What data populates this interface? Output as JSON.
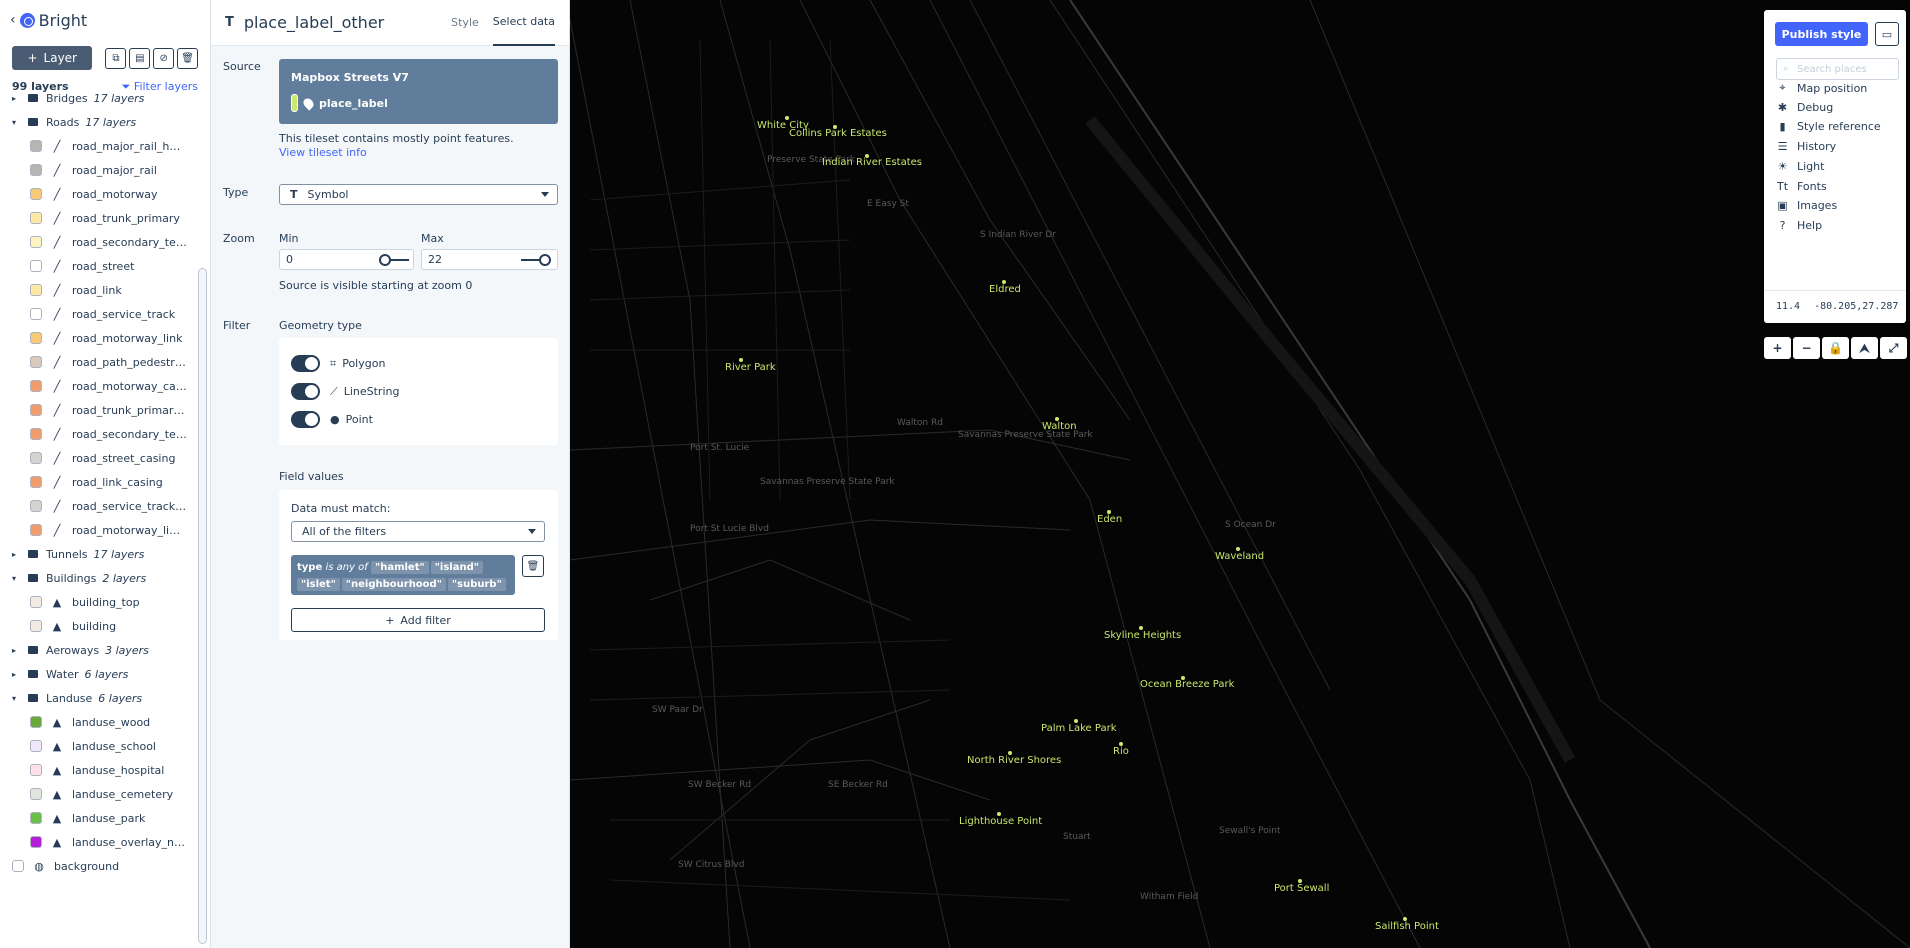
{
  "app": {
    "style_name": "Bright",
    "add_layer_label": "Layer",
    "layer_count": "99 layers",
    "filter_layers_label": "Filter layers"
  },
  "groups": [
    {
      "name": "Bridges",
      "count": "17 layers",
      "expanded": false,
      "layers": []
    },
    {
      "name": "Roads",
      "count": "17 layers",
      "expanded": true,
      "layers": [
        {
          "name": "road_major_rail_hatchi…",
          "color": "#b5b5b5",
          "icon": "line"
        },
        {
          "name": "road_major_rail",
          "color": "#b5b5b5",
          "icon": "line"
        },
        {
          "name": "road_motorway",
          "color": "#f7c97a",
          "icon": "line"
        },
        {
          "name": "road_trunk_primary",
          "color": "#fde9a5",
          "icon": "line"
        },
        {
          "name": "road_secondary_tertiary",
          "color": "#fdf4c2",
          "icon": "line"
        },
        {
          "name": "road_street",
          "color": "#ffffff",
          "icon": "line"
        },
        {
          "name": "road_link",
          "color": "#fde9a5",
          "icon": "line"
        },
        {
          "name": "road_service_track",
          "color": "#ffffff",
          "icon": "line"
        },
        {
          "name": "road_motorway_link",
          "color": "#f7c97a",
          "icon": "line"
        },
        {
          "name": "road_path_pedestrian",
          "color": "#d8cbbd",
          "icon": "line"
        },
        {
          "name": "road_motorway_casing",
          "color": "#ef9d6c",
          "icon": "line"
        },
        {
          "name": "road_trunk_primary_ca…",
          "color": "#ef9d6c",
          "icon": "line"
        },
        {
          "name": "road_secondary_tertia…",
          "color": "#ef9d6c",
          "icon": "line"
        },
        {
          "name": "road_street_casing",
          "color": "#d3d3d3",
          "icon": "line"
        },
        {
          "name": "road_link_casing",
          "color": "#ef9d6c",
          "icon": "line"
        },
        {
          "name": "road_service_track_cas…",
          "color": "#d3d3d3",
          "icon": "line"
        },
        {
          "name": "road_motorway_link_c…",
          "color": "#ef9d6c",
          "icon": "line"
        }
      ]
    },
    {
      "name": "Tunnels",
      "count": "17 layers",
      "expanded": false,
      "layers": []
    },
    {
      "name": "Buildings",
      "count": "2 layers",
      "expanded": true,
      "layers": [
        {
          "name": "building_top",
          "color": "#f2eae2",
          "icon": "fill"
        },
        {
          "name": "building",
          "color": "#f2eae2",
          "icon": "fill"
        }
      ]
    },
    {
      "name": "Aeroways",
      "count": "3 layers",
      "expanded": false,
      "layers": []
    },
    {
      "name": "Water",
      "count": "6 layers",
      "expanded": false,
      "layers": []
    },
    {
      "name": "Landuse",
      "count": "6 layers",
      "expanded": true,
      "layers": [
        {
          "name": "landuse_wood",
          "color": "#6aaa3a",
          "icon": "fill"
        },
        {
          "name": "landuse_school",
          "color": "#f0e8f8",
          "icon": "fill"
        },
        {
          "name": "landuse_hospital",
          "color": "#fde0ea",
          "icon": "fill"
        },
        {
          "name": "landuse_cemetery",
          "color": "#e0e4dd",
          "icon": "fill"
        },
        {
          "name": "landuse_park",
          "color": "#6ac04a",
          "icon": "fill"
        },
        {
          "name": "landuse_overlay_natio…",
          "color": "#b41fd6",
          "icon": "fill"
        }
      ]
    }
  ],
  "background_layer": {
    "name": "background",
    "color": "#ffffff"
  },
  "editor": {
    "layer_name": "place_label_other",
    "tabs": [
      "Style",
      "Select data"
    ],
    "source_label": "Source",
    "source_title": "Mapbox Streets V7",
    "source_layer": "place_label",
    "source_note": "This tileset contains mostly point features.",
    "tileset_link": "View tileset info",
    "type_label": "Type",
    "type_value": "Symbol",
    "zoom_label": "Zoom",
    "min_label": "Min",
    "max_label": "Max",
    "min_value": "0",
    "max_value": "22",
    "zoom_note": "Source is visible starting at zoom 0",
    "filter_label": "Filter",
    "geometry_label": "Geometry type",
    "geometry": [
      "Polygon",
      "LineString",
      "Point"
    ],
    "field_values_label": "Field values",
    "data_must_match": "Data must match:",
    "match_value": "All of the filters",
    "filter_field": "type",
    "filter_op": "is any of",
    "filter_values": [
      "\"hamlet\"",
      "\"island\"",
      "\"islet\"",
      "\"neighbourhood\"",
      "\"suburb\""
    ],
    "add_filter": "Add filter"
  },
  "map": {
    "places": [
      {
        "name": "White City"
      },
      {
        "name": "Collins Park Estates"
      },
      {
        "name": "Indian River Estates"
      },
      {
        "name": "Eldred"
      },
      {
        "name": "River Park"
      },
      {
        "name": "Walton"
      },
      {
        "name": "Eden"
      },
      {
        "name": "Waveland"
      },
      {
        "name": "Skyline Heights"
      },
      {
        "name": "Ocean Breeze Park"
      },
      {
        "name": "Palm Lake Park"
      },
      {
        "name": "Rio"
      },
      {
        "name": "North River Shores"
      },
      {
        "name": "Lighthouse Point"
      },
      {
        "name": "Port Sewall"
      },
      {
        "name": "Sailfish Point"
      }
    ],
    "labels": [
      "Preserve State Park",
      "E Easy St",
      "Port St. Lucie",
      "Savannas Preserve State Park",
      "Savannas Preserve State Park",
      "Walton Rd",
      "Port St Lucie Blvd",
      "SW Paar Dr",
      "SW Becker Rd",
      "Stuart",
      "Sewall's Point",
      "Witham Field",
      "SW Citrus Blvd",
      "S Indian River Dr",
      "S Ocean Dr",
      "SE Becker Rd"
    ]
  },
  "controls": {
    "publish": "Publish style",
    "search_placeholder": "Search places",
    "menu": [
      {
        "label": "Map position",
        "icon": "crosshair-icon",
        "glyph": "⌖"
      },
      {
        "label": "Debug",
        "icon": "bug-icon",
        "glyph": "✱"
      },
      {
        "label": "Style reference",
        "icon": "book-icon",
        "glyph": "▮"
      },
      {
        "label": "History",
        "icon": "history-icon",
        "glyph": "☰"
      },
      {
        "label": "Light",
        "icon": "light-icon",
        "glyph": "☀"
      },
      {
        "label": "Fonts",
        "icon": "fonts-icon",
        "glyph": "Tt"
      },
      {
        "label": "Images",
        "icon": "images-icon",
        "glyph": "▣"
      },
      {
        "label": "Help",
        "icon": "help-icon",
        "glyph": "?"
      }
    ],
    "zoom": "11.4",
    "coordinates": "-80.205,27.287",
    "buttons": [
      "+",
      "−",
      "🔒",
      "⮝",
      "⤢"
    ]
  }
}
